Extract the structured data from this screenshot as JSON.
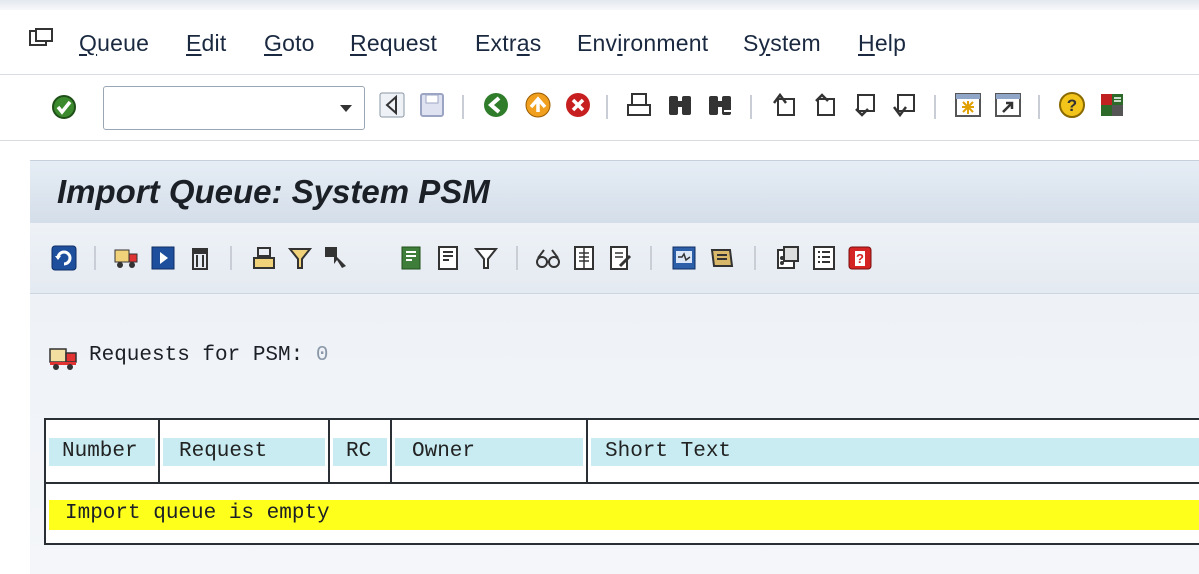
{
  "menubar": {
    "items": [
      {
        "label": "Queue",
        "underline": "Q",
        "rest": "ueue"
      },
      {
        "label": "Edit",
        "underline": "E",
        "rest": "dit"
      },
      {
        "label": "Goto",
        "underline": "G",
        "rest": "oto"
      },
      {
        "label": "Request",
        "underline": "R",
        "rest": "equest"
      },
      {
        "label": "Extras",
        "pre": "Extr",
        "underline": "a",
        "rest": "s"
      },
      {
        "label": "Environment",
        "pre": "Env",
        "underline": "i",
        "rest": "ronment"
      },
      {
        "label": "System",
        "pre": "S",
        "underline": "y",
        "rest": "stem"
      },
      {
        "label": "Help",
        "underline": "H",
        "rest": "elp"
      }
    ]
  },
  "command_field": {
    "value": "",
    "placeholder": ""
  },
  "title": "Import Queue: System PSM",
  "requests": {
    "label": "Requests for PSM:",
    "count": "0"
  },
  "table": {
    "columns": [
      "Number",
      "Request",
      "RC",
      "Owner",
      "Short Text"
    ],
    "empty_message": "Import queue is empty"
  },
  "colors": {
    "header_cell": "#c8ecf2",
    "empty_row": "#ffff1c",
    "title_bg": "#d4dee9"
  },
  "icons": {
    "standard_toolbar": [
      "enter-icon",
      "back-icon",
      "save-icon",
      "back-green-icon",
      "exit-icon",
      "cancel-icon",
      "print-icon",
      "find-icon",
      "find-next-icon",
      "first-page-icon",
      "previous-page-icon",
      "next-page-icon",
      "last-page-icon",
      "create-session-icon",
      "shortcut-icon",
      "help-icon",
      "customize-layout-icon"
    ],
    "application_toolbar": [
      "refresh-icon",
      "import-truck-icon",
      "start-import-icon",
      "delete-icon",
      "move-icon",
      "filter-icon",
      "select-icon",
      "select-block-icon",
      "deselect-icon",
      "set-filter-icon",
      "glasses-icon",
      "document-icon",
      "document-edit-icon",
      "monitor-icon",
      "truck-log-icon",
      "logs-icon",
      "list-icon",
      "alert-icon"
    ]
  }
}
